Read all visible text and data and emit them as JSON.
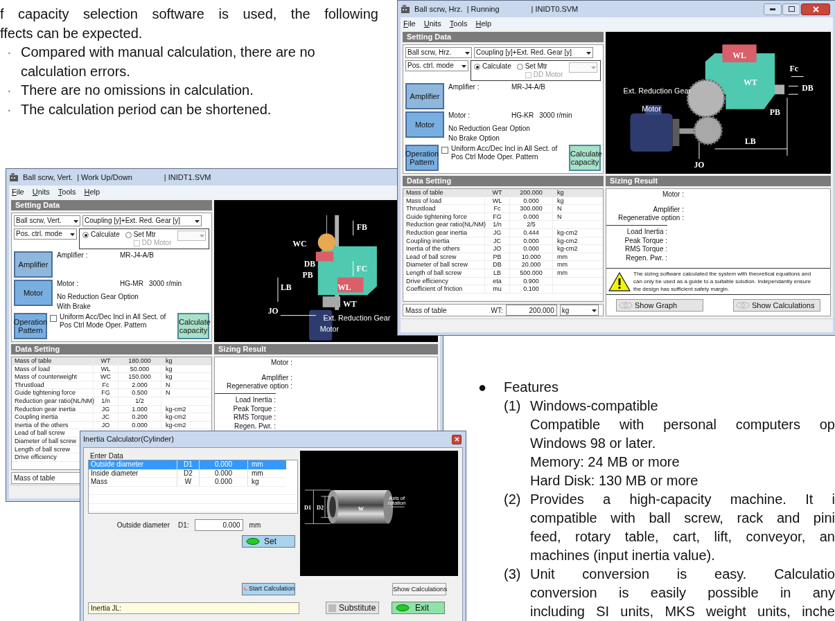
{
  "intro": {
    "lines": [
      {
        "text": "f capacity selection software is used, the following",
        "justified": true
      },
      {
        "text": "ffects can be expected.",
        "justified": false
      }
    ],
    "bullets": [
      {
        "marker": "·",
        "text": "Compared with manual calculation, there are no calculation errors."
      },
      {
        "marker": "·",
        "text": "There are no omissions in calculation."
      },
      {
        "marker": "·",
        "text": "The calculation period can be shortened."
      }
    ]
  },
  "windows": [
    {
      "kind": "horizontal",
      "title": [
        "Ball scrw, Hrz.",
        "| Running",
        "| INIDT0.SVM"
      ],
      "title_buttons": true,
      "menu": [
        "File",
        "Units",
        "Tools",
        "Help"
      ],
      "setting": {
        "header": "Setting Data",
        "selects": [
          "Ball scrw, Hrz.",
          "Coupling [y]+Ext. Red. Gear [y]",
          "Pos. ctrl. mode"
        ],
        "radios": [
          {
            "label": "Calculate",
            "selected": true
          },
          {
            "label": "Set Mtr",
            "selected": false
          }
        ],
        "dd_motor": {
          "label": "DD Motor",
          "checked": false,
          "disabled": true
        },
        "amplifier": {
          "button": "Amplifier",
          "label": "Amplifier :",
          "value": "MR-J4-A/B"
        },
        "motor": {
          "button": "Motor",
          "label": "Motor :",
          "model": "HG-KR",
          "speed": "3000 r/min",
          "notes": [
            "No Reduction Gear Option",
            "No Brake Option"
          ]
        },
        "operation": {
          "button": "Operation Pattern",
          "checkbox": {
            "label": "Uniform Acc/Dec Incl in All Sect. of Pos Ctrl Mode Oper. Pattern",
            "checked": false
          }
        },
        "calculate_button": "Calculate capacity"
      },
      "diagram": {
        "labels": [
          "WL",
          "Fc",
          "WT",
          "DB",
          "Ext. Reduction Gear",
          "Motor",
          "PB",
          "LB",
          "JO"
        ]
      },
      "data": {
        "header": "Data Setting",
        "rows": [
          {
            "label": "Mass of table",
            "symbol": "WT",
            "value": "200.000",
            "unit": "kg",
            "selected": true
          },
          {
            "label": "Mass of load",
            "symbol": "WL",
            "value": "0.000",
            "unit": "kg",
            "selected": false
          },
          {
            "label": "Thrustload",
            "symbol": "Fc",
            "value": "300.000",
            "unit": "N",
            "selected": false
          },
          {
            "label": "Guide tightening force",
            "symbol": "FG",
            "value": "0.000",
            "unit": "N",
            "selected": false
          },
          {
            "label": "Reduction gear ratio(NL/NM)",
            "symbol": "1/n",
            "value": "2/5",
            "selected": false
          },
          {
            "label": "Reduction gear inertia",
            "symbol": "JG",
            "value": "0.444",
            "unit": "kg-cm2",
            "selected": false
          },
          {
            "label": "Coupling inertia",
            "symbol": "JC",
            "value": "0.000",
            "unit": "kg-cm2",
            "selected": false
          },
          {
            "label": "Inertia of the others",
            "symbol": "JO",
            "value": "0.000",
            "unit": "kg-cm2",
            "selected": false
          },
          {
            "label": "Lead of ball screw",
            "symbol": "PB",
            "value": "10.000",
            "unit": "mm",
            "selected": false
          },
          {
            "label": "Diameter of ball screw",
            "symbol": "DB",
            "value": "20.000",
            "unit": "mm",
            "selected": false
          },
          {
            "label": "Length of ball screw",
            "symbol": "LB",
            "value": "500.000",
            "unit": "mm",
            "selected": false
          },
          {
            "label": "Drive efficiency",
            "symbol": "eta",
            "value": "0.900",
            "selected": false
          },
          {
            "label": "Coefficient of friction",
            "symbol": "mu",
            "value": "0.100",
            "selected": false
          }
        ],
        "field": {
          "label": "Mass of table",
          "symbol": "WT:",
          "value": "200.000",
          "unit": "kg"
        }
      },
      "sizing": {
        "header": "Sizing Result",
        "top": [
          "Motor :",
          "Amplifier :",
          "Regenerative option :"
        ],
        "middle": [
          "Load Inertia :",
          "Peak Torque :",
          "RMS Torque :",
          "Regen. Pwr. :"
        ],
        "warning": "The sizing software calculated the system with theoretical equations and can only be used as a guide to a suitable solution. Independantly ensure the design has sufficient safety margin.",
        "buttons": [
          "Show Graph",
          "Show Calculations"
        ]
      }
    },
    {
      "kind": "vertical",
      "title": [
        "Ball scrw, Vert.",
        "| Work Up/Down",
        "| INIDT1.SVM"
      ],
      "menu": [
        "File",
        "Units",
        "Tools",
        "Help"
      ],
      "setting": {
        "header": "Setting Data",
        "selects": [
          "Ball scrw, Vert.",
          "Coupling [y]+Ext. Red. Gear [y]",
          "Pos. ctrl. mode"
        ],
        "radios": [
          {
            "label": "Calculate",
            "selected": true
          },
          {
            "label": "Set Mtr",
            "selected": false
          }
        ],
        "dd_motor": {
          "label": "DD Motor",
          "checked": false,
          "disabled": true
        },
        "amplifier": {
          "button": "Amplifier",
          "label": "Amplifier :",
          "value": "MR-J4-A/B"
        },
        "motor": {
          "button": "Motor",
          "label": "Motor :",
          "model": "HG-MR",
          "speed": "3000 r/min",
          "notes": [
            "No Reduction Gear Option",
            "With Brake"
          ]
        },
        "operation": {
          "button": "Operation Pattern",
          "checkbox": {
            "label": "Uniform Acc/Dec Incl in All Sect. of Pos Ctrl Mode Oper. Pattern",
            "checked": false
          }
        },
        "calculate_button": "Calculate capacity"
      },
      "diagram": {
        "labels": [
          "FB",
          "WC",
          "DB",
          "FC",
          "PB",
          "LB",
          "WL",
          "WT",
          "JO",
          "Ext. Reduction Gear",
          "Motor"
        ]
      },
      "data": {
        "header": "Data Setting",
        "rows": [
          {
            "label": "Mass of table",
            "symbol": "WT",
            "value": "180.000",
            "unit": "kg",
            "selected": true
          },
          {
            "label": "Mass of load",
            "symbol": "WL",
            "value": "50.000",
            "unit": "kg",
            "selected": false
          },
          {
            "label": "Mass of counterweight",
            "symbol": "WC",
            "value": "150.000",
            "unit": "kg",
            "selected": false
          },
          {
            "label": "Thrustload",
            "symbol": "Fc",
            "value": "2.000",
            "unit": "N",
            "selected": false
          },
          {
            "label": "Guide tightening force",
            "symbol": "FG",
            "value": "0.500",
            "unit": "N",
            "selected": false
          },
          {
            "label": "Reduction gear ratio(NL/NM)",
            "symbol": "1/n",
            "value": "1/2",
            "selected": false
          },
          {
            "label": "Reduction gear inertia",
            "symbol": "JG",
            "value": "1.000",
            "unit": "kg-cm2",
            "selected": false
          },
          {
            "label": "Coupling inertia",
            "symbol": "JC",
            "value": "0.200",
            "unit": "kg-cm2",
            "selected": false
          },
          {
            "label": "Inertia of the others",
            "symbol": "JO",
            "value": "0.000",
            "unit": "kg-cm2",
            "selected": false
          },
          {
            "label": "Lead of ball screw",
            "selected": false
          },
          {
            "label": "Diameter of ball screw",
            "selected": false
          },
          {
            "label": "Length of ball screw",
            "selected": false
          },
          {
            "label": "Drive efficiency",
            "selected": false
          }
        ],
        "field": {
          "label": "Mass of table"
        }
      },
      "sizing": {
        "header": "Sizing Result",
        "top": [
          "Motor :",
          "Amplifier :",
          "Regenerative option :"
        ],
        "middle": [
          "Load Inertia :",
          "Peak Torque :",
          "RMS Torque :",
          "Regen. Pwr. :"
        ]
      }
    }
  ],
  "dialog": {
    "title": "Inertia Calculator(Cylinder)",
    "section": "Enter Data",
    "rows": [
      {
        "label": "Outside diameter",
        "symbol": "D1",
        "value": "0.000",
        "unit": "mm",
        "selected": true
      },
      {
        "label": "Inside diameter",
        "symbol": "D2",
        "value": "0.000",
        "unit": "mm",
        "selected": false
      },
      {
        "label": "Mass",
        "symbol": "W",
        "value": "0.000",
        "unit": "kg",
        "selected": false
      }
    ],
    "field": {
      "label": "Outside diameter",
      "symbol": "D1:",
      "value": "0.000",
      "unit": "mm"
    },
    "set_button": "Set",
    "start_button": "Start Calculation",
    "show_button": "Show Calculations",
    "result_label": "Inertia JL:",
    "substitute_button": "Substitute",
    "exit_button": "Exit",
    "diagram": {
      "labels": [
        "D1",
        "D2",
        "W",
        "Axis of",
        "rotation"
      ]
    }
  },
  "features": {
    "marker": "●",
    "title": "Features",
    "items": [
      {
        "number": "(1)",
        "lines": [
          {
            "text": "Windows-compatible"
          },
          {
            "text": "Compatible with personal computers op",
            "justified": true
          },
          {
            "text": "Windows 98 or later.",
            "justified": false
          },
          {
            "text": "Memory: 24 MB or more",
            "justified": false
          },
          {
            "text": "Hard Disk: 130 MB or more",
            "justified": false
          }
        ]
      },
      {
        "number": "(2)",
        "lines": [
          {
            "text": "Provides a high-capacity machine. It i",
            "justified": true
          },
          {
            "text": "compatible with ball screw, rack and pini",
            "justified": true
          },
          {
            "text": "feed, rotary table, cart, lift, conveyor, an",
            "justified": true
          },
          {
            "text": "machines (input inertia value).",
            "justified": false
          }
        ]
      },
      {
        "number": "(3)",
        "lines": [
          {
            "text": "Unit conversion is easy. Calculatio",
            "justified": true
          },
          {
            "text": "conversion is easily possible in any",
            "justified": true
          },
          {
            "text": "including SI units, MKS weight units, inche",
            "justified": true
          }
        ]
      }
    ]
  }
}
